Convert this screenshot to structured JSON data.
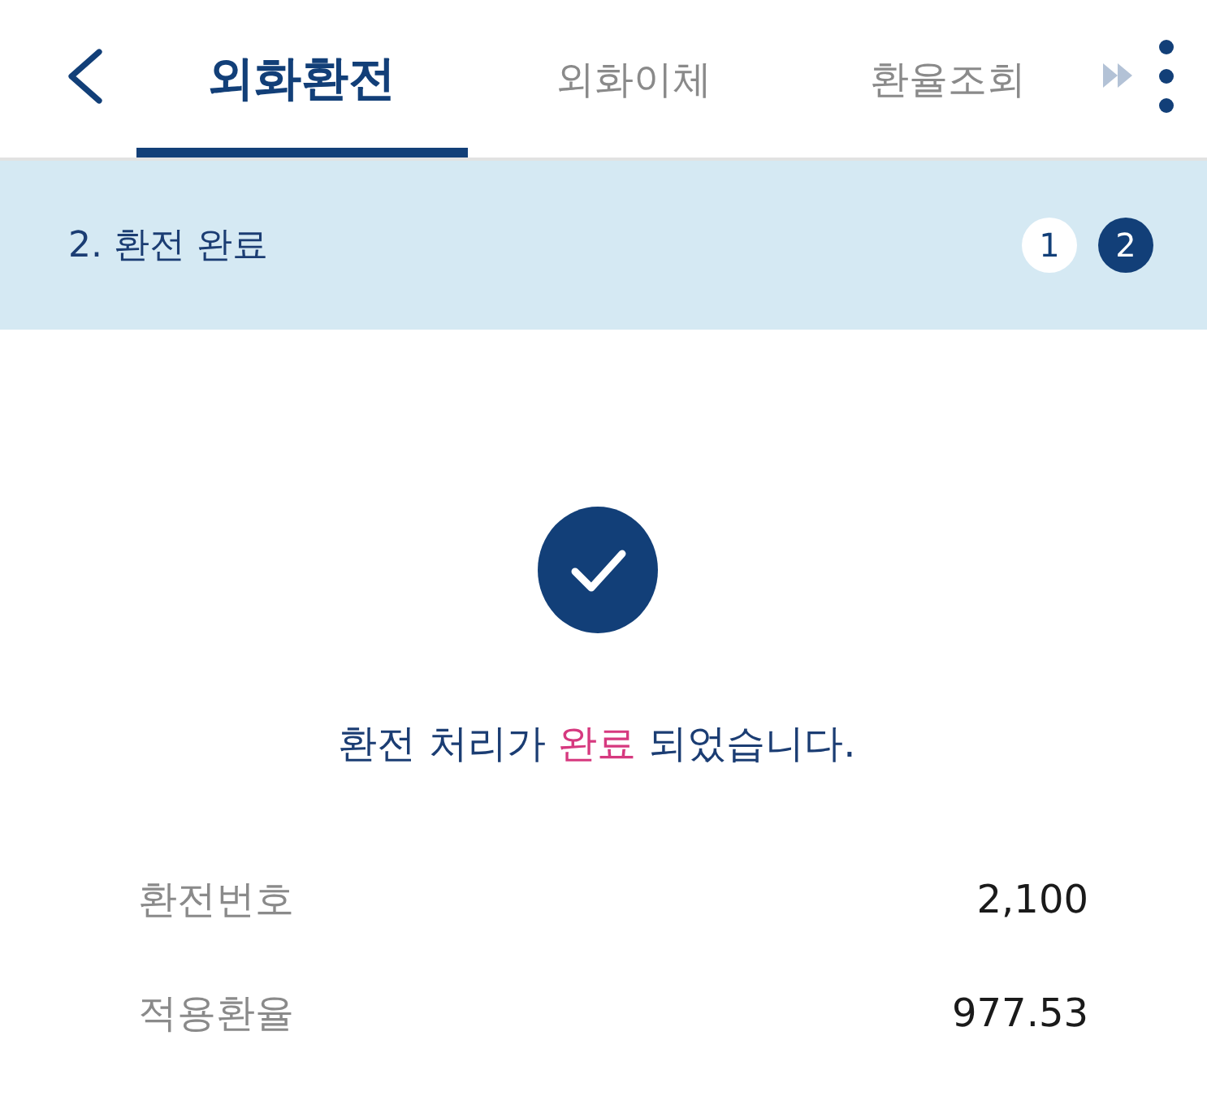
{
  "header": {
    "tabs": [
      {
        "label": "외화환전",
        "selected": true
      },
      {
        "label": "외화이체",
        "selected": false
      },
      {
        "label": "환율조회",
        "selected": false
      }
    ]
  },
  "step_banner": {
    "title": "2. 환전 완료",
    "steps": [
      {
        "label": "1",
        "selected": false
      },
      {
        "label": "2",
        "selected": true
      }
    ]
  },
  "result": {
    "message": [
      {
        "text": "환전 처리가 ",
        "highlight": false
      },
      {
        "text": "완료",
        "highlight": true
      },
      {
        "text": " 되었습니다.",
        "highlight": false
      }
    ]
  },
  "details": [
    {
      "label": "환전번호",
      "value": "2,100"
    },
    {
      "label": "적용환율",
      "value": "977.53"
    }
  ]
}
